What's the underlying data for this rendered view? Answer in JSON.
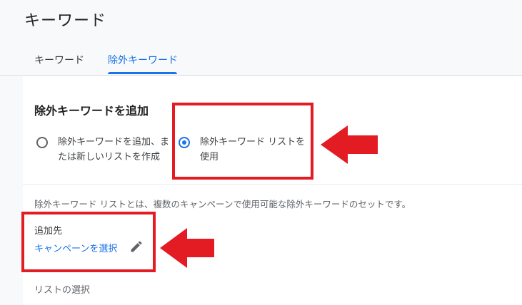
{
  "page": {
    "title": "キーワード"
  },
  "tabs": [
    {
      "label": "キーワード",
      "selected": false
    },
    {
      "label": "除外キーワード",
      "selected": true
    }
  ],
  "section": {
    "title": "除外キーワードを追加",
    "options": [
      {
        "label": "除外キーワードを追加、または新しいリストを作成",
        "checked": false
      },
      {
        "label": "除外キーワード リストを使用",
        "checked": true
      }
    ],
    "description": "除外キーワード リストとは、複数のキャンペーンで使用可能な除外キーワードのセットです。",
    "destination_label": "追加先",
    "campaign_link": "キャンペーンを選択",
    "list_select_label": "リストの選択"
  },
  "icons": {
    "pencil": "pencil-icon",
    "arrow": "red-arrow-icon"
  },
  "colors": {
    "accent": "#1a73e8",
    "highlight": "#e31b23",
    "text": "#202124",
    "muted": "#5f6368"
  }
}
